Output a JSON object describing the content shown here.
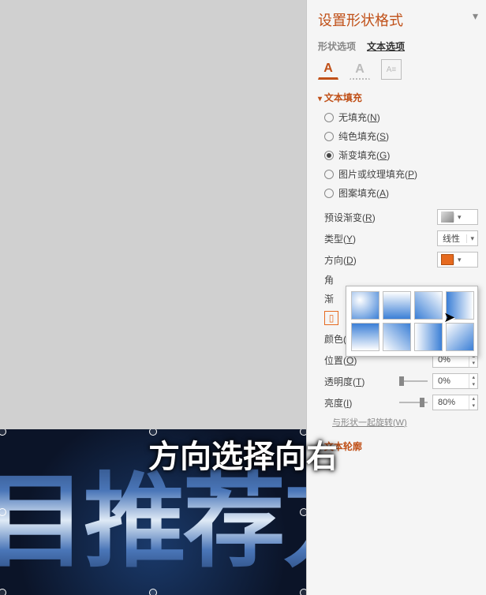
{
  "panel": {
    "title": "设置形状格式",
    "tabs": {
      "shape": "形状选项",
      "text": "文本选项"
    },
    "sections": {
      "fill": "文本填充",
      "outline": "文本轮廓"
    },
    "radios": {
      "none": {
        "label": "无填充",
        "key": "N"
      },
      "solid": {
        "label": "纯色填充",
        "key": "S"
      },
      "gradient": {
        "label": "渐变填充",
        "key": "G"
      },
      "picture": {
        "label": "图片或纹理填充",
        "key": "P"
      },
      "pattern": {
        "label": "图案填充",
        "key": "A"
      },
      "selected": "gradient"
    },
    "props": {
      "preset": {
        "label": "预设渐变",
        "key": "R"
      },
      "type": {
        "label": "类型",
        "key": "Y",
        "value": "线性"
      },
      "direction": {
        "label": "方向",
        "key": "D"
      },
      "angle": {
        "label": "角度",
        "short": "角"
      },
      "stops": {
        "label": "渐变",
        "short": "渐"
      },
      "color": {
        "label": "颜色",
        "key": "C"
      },
      "position": {
        "label": "位置",
        "key": "O",
        "value": "0%"
      },
      "transparency": {
        "label": "透明度",
        "key": "T",
        "value": "0%"
      },
      "brightness": {
        "label": "亮度",
        "key": "I",
        "value": "80%"
      },
      "rotate_with_shape": {
        "label": "与形状一起旋转",
        "key": "W"
      }
    }
  },
  "canvas": {
    "text_content": "目推荐方",
    "caption": "方向选择向右"
  },
  "chart_data": null
}
